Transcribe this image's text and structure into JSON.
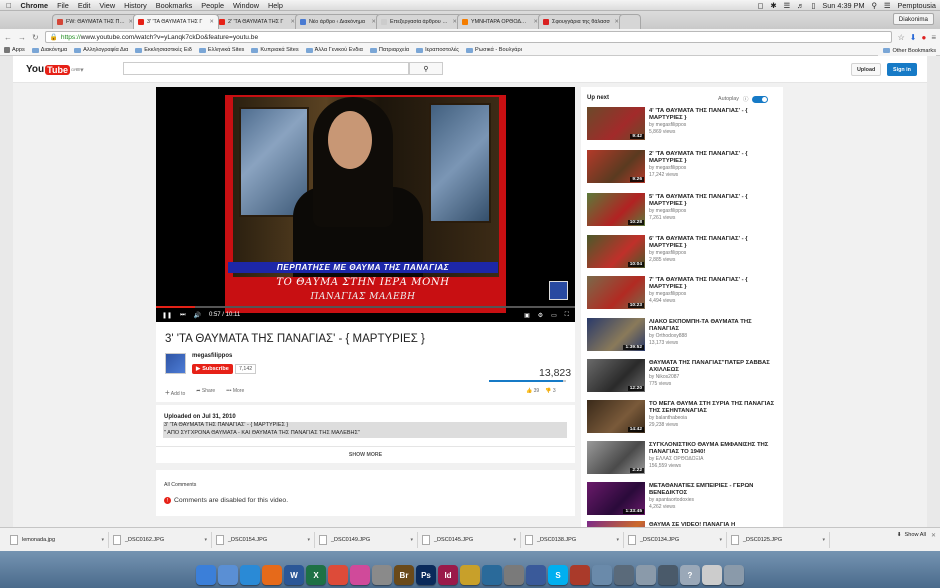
{
  "os_menubar": {
    "app": "Chrome",
    "menus": [
      "File",
      "Edit",
      "View",
      "History",
      "Bookmarks",
      "People",
      "Window",
      "Help"
    ],
    "clock": "Sun 4:39 PM",
    "user": "Pemptousia"
  },
  "browser": {
    "profile": "Diakonima",
    "tabs": [
      {
        "label": "FW: ΘΑΥΜΑΤΑ ΤΗΣ ΠΑΝΑΓ",
        "favicon_color": "#d44638",
        "active": false
      },
      {
        "label": "3' 'ΤΑ ΘΑΥΜΑΤΑ ΤΗΣ Γ",
        "favicon_color": "#e62117",
        "active": true
      },
      {
        "label": "2' 'ΤΑ ΘΑΥΜΑΤΑ ΤΗΣ Γ",
        "favicon_color": "#e62117",
        "active": false
      },
      {
        "label": "Νέο άρθρο ‹ Διακόνημα",
        "favicon_color": "#4a7bd2",
        "active": false
      },
      {
        "label": "Επεξεργασία άρθρου ‹ Δι",
        "favicon_color": "#cccccc",
        "active": false
      },
      {
        "label": "ΥΜΝΗΤΑΡΑ ΟΡΘΟΔΟΞΙΑΣ",
        "favicon_color": "#f57d00",
        "active": false
      },
      {
        "label": "Σφουγγάρια της θάλασσ",
        "favicon_color": "#d92121",
        "active": false
      }
    ],
    "url_scheme": "https://",
    "url_rest": "www.youtube.com/watch?v=yLanqk7ckDo&feature=youtu.be",
    "bookmarks": [
      "Apps",
      "Διακόνημα",
      "Αλληλογραφία Δια",
      "Εκκλησιαστικές Ειδ",
      "Ελληνικά Sites",
      "Κυπριακά Sites",
      "Άλλα Γενικού Ενδια",
      "Πατριαρχεία",
      "Ιεραποστολές",
      "Ρωσικά - Βουλγάρι"
    ],
    "other_bookmarks": "Other Bookmarks"
  },
  "youtube": {
    "logo_text": "You",
    "logo_tube": "Tube",
    "logo_region": "GR",
    "upload_label": "Upload",
    "signin_label": "Sign in",
    "player": {
      "caption_line1": "ΠΕΡΠΑΤΗΣΕ ΜΕ ΘΑΥΜΑ ΤΗΣ ΠΑΝΑΓΙΑΣ",
      "caption_line2": "ΤΟ ΘΑΥΜΑ ΣΤΗΝ ΙΕΡΑ ΜΟΝΗ",
      "caption_line3": "ΠΑΝΑΓΙΑΣ ΜΑΛΕΒΗ",
      "time": "0:57 / 10:11",
      "progress": 0.093
    },
    "video_title": "3' 'ΤΑ ΘΑΥΜΑΤΑ ΤΗΣ ΠΑΝΑΓΙΑΣ' - { ΜΑΡΤΥΡΙΕΣ }",
    "channel": "megasfilippos",
    "subscribe_label": "Subscribe",
    "subscriber_count": "7,142",
    "view_count": "13,823",
    "action_add": "Add to",
    "action_share": "Share",
    "action_more": "More",
    "likes": "39",
    "dislikes": "3",
    "uploaded_on": "Uploaded on Jul 31, 2010",
    "description_line1": "3' 'ΤΑ ΘΑΥΜΑΤΑ ΤΗΣ ΠΑΝΑΓΙΑΣ' - { ΜΑΡΤΥΡΙΕΣ }",
    "description_line2": "\" ΑΠΟ ΣΥΓΧΡΟΝΑ ΘΑΥΜΑΤΑ - ΚΑΙ ΘΑΥΜΑΤΑ ΤΗΣ ΠΑΝΑΓΙΑΣ ΤΗΣ ΜΑΛΕΒΗΣ\"",
    "show_more": "SHOW MORE",
    "all_comments": "All Comments",
    "comments_disabled": "Comments are disabled for this video.",
    "up_next": "Up next",
    "autoplay_label": "Autoplay",
    "related": [
      {
        "title": "4' 'ΤΑ ΘΑΥΜΑΤΑ ΤΗΣ ΠΑΝΑΓΙΑΣ' - { ΜΑΡΤΥΡΙΕΣ }",
        "channel": "by megasfilippos",
        "views": "5,869 views",
        "duration": "9:42",
        "c1": "#6b4a2a",
        "c2": "#a22a2a"
      },
      {
        "title": "2' 'ΤΑ ΘΑΥΜΑΤΑ ΤΗΣ ΠΑΝΑΓΙΑΣ' - { ΜΑΡΤΥΡΙΕΣ }",
        "channel": "by megasfilippos",
        "views": "17,242 views",
        "duration": "9:26",
        "c1": "#b33a2a",
        "c2": "#5a3a20"
      },
      {
        "title": "5' 'ΤΑ ΘΑΥΜΑΤΑ ΤΗΣ ΠΑΝΑΓΙΑΣ' - { ΜΑΡΤΥΡΙΕΣ }",
        "channel": "by megasfilippos",
        "views": "7,261 views",
        "duration": "10:28",
        "c1": "#5c7a3a",
        "c2": "#b22222"
      },
      {
        "title": "6' 'ΤΑ ΘΑΥΜΑΤΑ ΤΗΣ ΠΑΝΑΓΙΑΣ' - { ΜΑΡΤΥΡΙΕΣ }",
        "channel": "by megasfilippos",
        "views": "2,885 views",
        "duration": "10:04",
        "c1": "#4a5a2a",
        "c2": "#c0302a"
      },
      {
        "title": "7' 'ΤΑ ΘΑΥΜΑΤΑ ΤΗΣ ΠΑΝΑΓΙΑΣ' - { ΜΑΡΤΥΡΙΕΣ }",
        "channel": "by megasfilippos",
        "views": "4,494 views",
        "duration": "10:23",
        "c1": "#7a6a4a",
        "c2": "#b22a22"
      },
      {
        "title": "ΛΙΑΚΟ ΕΚΠΟΜΠΗ-ΤΑ ΘΑΥΜΑΤΑ ΤΗΣ ΠΑΝΑΓΙΑΣ",
        "channel": "by Orthodoxy888",
        "views": "13,173 views",
        "duration": "1:39:52",
        "c1": "#2a3a6a",
        "c2": "#8a7a5a"
      },
      {
        "title": "ΘΑΥΜΑΤΑ ΤΗΣ ΠΑΝΑΓΙΑΣ\"ΠΑΤΕΡ ΣΑΒΒΑΣ ΑΧΙΛΛΕΩΣ",
        "channel": "by Nikos2087",
        "views": "775 views",
        "duration": "12:20",
        "c1": "#6a6a6a",
        "c2": "#2a2a2a"
      },
      {
        "title": "ΤΟ ΜΕΓΑ ΘΑΥΜΑ ΣΤΗ ΣΥΡΙΑ ΤΗΣ ΠΑΝΑΓΙΑΣ ΤΗΣ ΣΕΗΝΤΑΝΑΓΙΑΣ",
        "channel": "by balanthabeoia",
        "views": "29,238 views",
        "duration": "14:42",
        "c1": "#3a2a1a",
        "c2": "#7a5a3a"
      },
      {
        "title": "ΣΥΓΚΛΟΝΙΣΤΙΚΟ ΘΑΥΜΑ ΕΜΦΑΝΙΣΗΣ ΤΗΣ ΠΑΝΑΓΙΑΣ ΤΟ 1940!",
        "channel": "by ΕΛΛΑΣ ΟΡΘΟΔΟΞΙΑ",
        "views": "156,559 views",
        "duration": "2:22",
        "c1": "#9a9a9a",
        "c2": "#4a4a4a"
      },
      {
        "title": "ΜΕΤΑΘΑΝΑΤΙΕΣ ΕΜΠΕΙΡΙΕΣ - ΓΕΡΩΝ ΒΕΝΕΔΙΚΤΟΣ",
        "channel": "by apantaortodoxies",
        "views": "4,262 views",
        "duration": "1:33:45",
        "c1": "#6a1a6a",
        "c2": "#2a0a3a"
      },
      {
        "title": "ΘΑΥΜΑ ΣΕ VIDEO! ΠΑΝΑΓΙΑ Η",
        "channel": "",
        "views": "",
        "duration": "",
        "c1": "#7a2a8a",
        "c2": "#cc6a2a"
      }
    ]
  },
  "downloads": {
    "items": [
      "lemonada.jpg",
      "_DSC0162.JPG",
      "_DSC0154.JPG",
      "_DSC0149.JPG",
      "_DSC0145.JPG",
      "_DSC0138.JPG",
      "_DSC0134.JPG",
      "_DSC0125.JPG"
    ],
    "show_all": "Show All"
  },
  "dock": {
    "apps": [
      {
        "name": "finder-icon",
        "color": "#3b7fd9",
        "label": ""
      },
      {
        "name": "mail-icon",
        "color": "#5a8fd4",
        "label": ""
      },
      {
        "name": "safari-icon",
        "color": "#2a8ad6",
        "label": ""
      },
      {
        "name": "firefox-icon",
        "color": "#e66a1a",
        "label": ""
      },
      {
        "name": "word-icon",
        "color": "#2b5797",
        "label": "W"
      },
      {
        "name": "excel-icon",
        "color": "#1e7145",
        "label": "X"
      },
      {
        "name": "chrome-icon",
        "color": "#dd4b39",
        "label": ""
      },
      {
        "name": "itunes-icon",
        "color": "#d04a9a",
        "label": ""
      },
      {
        "name": "preview-icon",
        "color": "#8a8a8a",
        "label": ""
      },
      {
        "name": "bridge-icon",
        "color": "#6a4a1a",
        "label": "Br"
      },
      {
        "name": "photoshop-icon",
        "color": "#0a2a5a",
        "label": "Ps"
      },
      {
        "name": "indesign-icon",
        "color": "#9a1a4a",
        "label": "Id"
      },
      {
        "name": "app-icon-1",
        "color": "#c8a02a",
        "label": ""
      },
      {
        "name": "app-icon-2",
        "color": "#2a6a9a",
        "label": ""
      },
      {
        "name": "app-icon-3",
        "color": "#7a7a7a",
        "label": ""
      },
      {
        "name": "app-icon-4",
        "color": "#3a5a9a",
        "label": ""
      },
      {
        "name": "skype-icon",
        "color": "#00aff0",
        "label": "S"
      },
      {
        "name": "app-icon-5",
        "color": "#aa3a2a",
        "label": ""
      },
      {
        "name": "app-icon-6",
        "color": "#6a8aaa",
        "label": ""
      },
      {
        "name": "app-icon-7",
        "color": "#5a6a7a",
        "label": ""
      },
      {
        "name": "app-icon-8",
        "color": "#8a9aaa",
        "label": ""
      },
      {
        "name": "app-icon-9",
        "color": "#4a5a6a",
        "label": ""
      },
      {
        "name": "help-icon",
        "color": "#9aa8b8",
        "label": "?"
      },
      {
        "name": "app-icon-10",
        "color": "#cccccc",
        "label": ""
      },
      {
        "name": "trash-icon",
        "color": "#8a9aaa",
        "label": ""
      }
    ]
  }
}
